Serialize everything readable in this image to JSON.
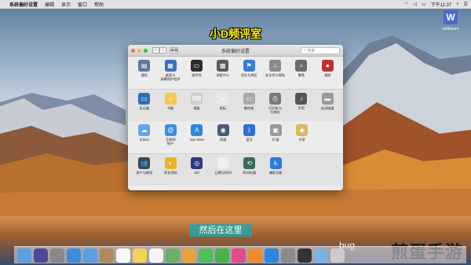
{
  "menubar": {
    "apple_icon": "apple-icon",
    "items": [
      "系统偏好设置",
      "编辑",
      "显示",
      "窗口",
      "帮助"
    ],
    "right": {
      "clock": "下午11:37"
    }
  },
  "logo": {
    "mark": "W",
    "text": "wellshare"
  },
  "caption_top": "小D频评室",
  "window": {
    "title": "系统偏好设置",
    "search_placeholder": "搜索",
    "sections": [
      [
        {
          "label": "通用",
          "icon": "general-icon",
          "color": "#5a78a0",
          "glyph": "▤"
        },
        {
          "label": "桌面与\n屏幕保护程序",
          "icon": "desktop-icon",
          "color": "#3c6fb5",
          "glyph": "▦"
        },
        {
          "label": "程序坞",
          "icon": "dock-icon",
          "color": "#2c2c2c",
          "glyph": "▭"
        },
        {
          "label": "调度中心",
          "icon": "mission-control-icon",
          "color": "#5b5b5b",
          "glyph": "▩"
        },
        {
          "label": "语言与地区",
          "icon": "language-icon",
          "color": "#3a7bd5",
          "glyph": "⚑"
        },
        {
          "label": "安全性与隐私",
          "icon": "security-icon",
          "color": "#8a8a8a",
          "glyph": "⌂"
        },
        {
          "label": "聚焦",
          "icon": "spotlight-icon",
          "color": "#6a6a6a",
          "glyph": "⌕"
        },
        {
          "label": "通知",
          "icon": "notifications-icon",
          "color": "#b33",
          "glyph": "●"
        }
      ],
      [
        {
          "label": "显示器",
          "icon": "displays-icon",
          "color": "#2a6fbd",
          "glyph": "▭"
        },
        {
          "label": "节能",
          "icon": "energy-icon",
          "color": "#f2c94c",
          "glyph": "☼"
        },
        {
          "label": "键盘",
          "icon": "keyboard-icon",
          "color": "#cfcfcf",
          "glyph": "⌨"
        },
        {
          "label": "鼠标",
          "icon": "mouse-icon",
          "color": "#e9e9e9",
          "glyph": "◗"
        },
        {
          "label": "触控板",
          "icon": "trackpad-icon",
          "color": "#a8a8a8",
          "glyph": "▭"
        },
        {
          "label": "打印机与\n扫描仪",
          "icon": "printer-icon",
          "color": "#7a7a7a",
          "glyph": "⎙"
        },
        {
          "label": "声音",
          "icon": "sound-icon",
          "color": "#555",
          "glyph": "♪"
        },
        {
          "label": "启动磁盘",
          "icon": "startup-disk-icon",
          "color": "#9a9a9a",
          "glyph": "▬"
        }
      ],
      [
        {
          "label": "iCloud",
          "icon": "icloud-icon",
          "color": "#5fa7e8",
          "glyph": "☁"
        },
        {
          "label": "互联网\n帐户",
          "icon": "internet-accounts-icon",
          "color": "#3b8de0",
          "glyph": "@"
        },
        {
          "label": "App Store",
          "icon": "app-store-icon",
          "color": "#2a86e0",
          "glyph": "A"
        },
        {
          "label": "网络",
          "icon": "network-icon",
          "color": "#4a5a7a",
          "glyph": "◉"
        },
        {
          "label": "蓝牙",
          "icon": "bluetooth-icon",
          "color": "#2b6fd1",
          "glyph": "ᛒ"
        },
        {
          "label": "扩展",
          "icon": "extensions-icon",
          "color": "#9a9a9a",
          "glyph": "▣"
        },
        {
          "label": "共享",
          "icon": "sharing-icon",
          "color": "#d9b85c",
          "glyph": "◆"
        }
      ],
      [
        {
          "label": "用户与群组",
          "icon": "users-icon",
          "color": "#444",
          "glyph": "👥"
        },
        {
          "label": "家长控制",
          "icon": "parental-controls-icon",
          "color": "#e5b525",
          "glyph": "◐"
        },
        {
          "label": "Siri",
          "icon": "siri-icon",
          "color": "#2a3a7a",
          "glyph": "◎"
        },
        {
          "label": "日期与时间",
          "icon": "date-time-icon",
          "color": "#eee",
          "glyph": "◷"
        },
        {
          "label": "时间机器",
          "icon": "time-machine-icon",
          "color": "#3a6a5a",
          "glyph": "⟲"
        },
        {
          "label": "辅助功能",
          "icon": "accessibility-icon",
          "color": "#2a7ae0",
          "glyph": "♿"
        }
      ]
    ]
  },
  "subtitle": "然后在这里",
  "dock": {
    "apps": [
      {
        "name": "finder-icon",
        "color": "#5aa0e0"
      },
      {
        "name": "siri-dock-icon",
        "color": "#4a4a9a"
      },
      {
        "name": "launchpad-icon",
        "color": "#888"
      },
      {
        "name": "safari-icon",
        "color": "#3a8ee0"
      },
      {
        "name": "mail-icon",
        "color": "#5aa0e0"
      },
      {
        "name": "contacts-icon",
        "color": "#b08a5a"
      },
      {
        "name": "calendar-icon",
        "color": "#fafafa"
      },
      {
        "name": "notes-icon",
        "color": "#f2d45c"
      },
      {
        "name": "reminders-icon",
        "color": "#f5f5f5"
      },
      {
        "name": "maps-icon",
        "color": "#6ab06a"
      },
      {
        "name": "photos-icon",
        "color": "#e9a23b"
      },
      {
        "name": "messages-icon",
        "color": "#4cc05a"
      },
      {
        "name": "facetime-icon",
        "color": "#45b24a"
      },
      {
        "name": "itunes-icon",
        "color": "#e34a8a"
      },
      {
        "name": "ibooks-icon",
        "color": "#f08a2a"
      },
      {
        "name": "app-store-dock-icon",
        "color": "#2a86e0"
      },
      {
        "name": "system-preferences-dock-icon",
        "color": "#8a8a8a"
      },
      {
        "name": "terminal-icon",
        "color": "#333"
      },
      {
        "name": "folder-icon",
        "color": "#7ab2e8"
      },
      {
        "name": "trash-icon",
        "color": "#ccc"
      }
    ]
  },
  "watermark": "bug",
  "watermark2": "煎蛋手游",
  "colors": {
    "caption": "#fff200",
    "subtitle_bg": "#2ba0a0"
  }
}
